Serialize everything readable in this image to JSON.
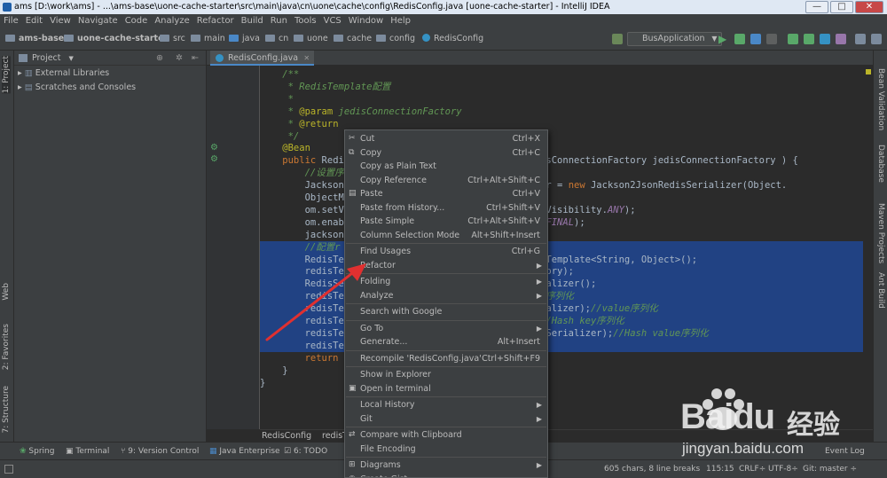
{
  "window": {
    "title": "ams [D:\\work\\ams] - ...\\ams-base\\uone-cache-starter\\src\\main\\java\\cn\\uone\\cache\\config\\RedisConfig.java [uone-cache-starter] - IntelliJ IDEA",
    "minimize": "—",
    "maximize": "□",
    "close": "✕"
  },
  "menu": [
    "File",
    "Edit",
    "View",
    "Navigate",
    "Code",
    "Analyze",
    "Refactor",
    "Build",
    "Run",
    "Tools",
    "VCS",
    "Window",
    "Help"
  ],
  "navbar": {
    "crumbs": [
      "ams-base",
      "uone-cache-starter",
      "src",
      "main",
      "java",
      "cn",
      "uone",
      "cache",
      "config",
      "RedisConfig"
    ],
    "run_config": "BusApplication"
  },
  "left_strip": {
    "project": "1: Project",
    "web": "Web",
    "favorites": "2: Favorites",
    "structure": "7: Structure"
  },
  "right_strip": {
    "bean": "Bean Validation",
    "database": "Database",
    "maven": "Maven Projects",
    "ant": "Ant Build"
  },
  "project_panel": {
    "header": "Project",
    "items": [
      "External Libraries",
      "Scratches and Consoles"
    ]
  },
  "editor": {
    "tab": "RedisConfig.java",
    "breadcrumbs": [
      "RedisConfig",
      "redisT"
    ]
  },
  "code_lines": [
    {
      "segments": [
        {
          "c": "cm",
          "t": "    /**"
        }
      ],
      "sel": false
    },
    {
      "segments": [
        {
          "c": "cm",
          "t": "     * RedisTemplate配置"
        }
      ],
      "sel": false
    },
    {
      "segments": [
        {
          "c": "cm",
          "t": "     *"
        }
      ],
      "sel": false
    },
    {
      "segments": [
        {
          "c": "cm",
          "t": "     * "
        },
        {
          "c": "an",
          "t": "@param"
        },
        {
          "c": "cm",
          "t": " jedisConnectionFactory"
        }
      ],
      "sel": false
    },
    {
      "segments": [
        {
          "c": "cm",
          "t": "     * "
        },
        {
          "c": "an",
          "t": "@return"
        }
      ],
      "sel": false
    },
    {
      "segments": [
        {
          "c": "cm",
          "t": "     */"
        }
      ],
      "sel": false
    },
    {
      "segments": [
        {
          "c": "an",
          "t": "    @Bean"
        }
      ],
      "sel": false
    },
    {
      "segments": [
        {
          "c": "kw",
          "t": "    public "
        },
        {
          "c": "",
          "t": "Redi                          plate(JedisConnectionFactory jedisConnectionFactory ) {"
        }
      ],
      "sel": false
    },
    {
      "segments": [
        {
          "c": "cm",
          "t": "        //设置序"
        }
      ],
      "sel": false
    },
    {
      "segments": [
        {
          "c": "",
          "t": "        Jackson                       edisSerializer = "
        },
        {
          "c": "kw",
          "t": "new "
        },
        {
          "c": "",
          "t": "Jackson2JsonRedisSerializer(Object."
        }
      ],
      "sel": false
    },
    {
      "segments": [
        {
          "c": "",
          "t": "        ObjectM"
        }
      ],
      "sel": false
    },
    {
      "segments": [
        {
          "c": "",
          "t": "        om.setV                       onAutoDetect.Visibility."
        },
        {
          "c": "it",
          "t": "ANY"
        },
        {
          "c": "",
          "t": ");"
        }
      ],
      "sel": false
    },
    {
      "segments": [
        {
          "c": "",
          "t": "        om.enab                       ltTyping."
        },
        {
          "c": "it",
          "t": "NON_FINAL"
        },
        {
          "c": "",
          "t": ");"
        }
      ],
      "sel": false
    },
    {
      "segments": [
        {
          "c": "",
          "t": "        jackson                       er(om);"
        }
      ],
      "sel": false
    },
    {
      "segments": [
        {
          "c": "cm",
          "t": "        //配置r"
        }
      ],
      "sel": true
    },
    {
      "segments": [
        {
          "c": "",
          "t": "        RedisTe                       e = "
        },
        {
          "c": "kw",
          "t": "new "
        },
        {
          "c": "",
          "t": "RedisTemplate<String, Object>();"
        }
      ],
      "sel": true
    },
    {
      "segments": [
        {
          "c": "",
          "t": "        redisTe                       onnectionFactory);"
        }
      ],
      "sel": true
    },
    {
      "segments": [
        {
          "c": "",
          "t": "        RedisSe                       ringRedisSerializer();"
        }
      ],
      "sel": true
    },
    {
      "segments": [
        {
          "c": "",
          "t": "        redisTe                       alizer);"
        },
        {
          "c": "cm",
          "t": "//key序列化"
        }
      ],
      "sel": true
    },
    {
      "segments": [
        {
          "c": "",
          "t": "        redisTe                       JsonRedisSerializer);"
        },
        {
          "c": "cm",
          "t": "//value序列化"
        }
      ],
      "sel": true
    },
    {
      "segments": [
        {
          "c": "",
          "t": "        redisTe                       Serializer);"
        },
        {
          "c": "cm",
          "t": "//Hash key序列化"
        }
      ],
      "sel": true
    },
    {
      "segments": [
        {
          "c": "",
          "t": "        redisTe                       son2JsonRedisSerializer);"
        },
        {
          "c": "cm",
          "t": "//Hash value序列化"
        }
      ],
      "sel": true
    },
    {
      "segments": [
        {
          "c": "",
          "t": "        redisTe"
        }
      ],
      "sel": true
    },
    {
      "segments": [
        {
          "c": "kw",
          "t": "        return "
        }
      ],
      "sel": false
    },
    {
      "segments": [
        {
          "c": "",
          "t": "    }"
        }
      ],
      "sel": false
    },
    {
      "segments": [
        {
          "c": "",
          "t": "}"
        }
      ],
      "sel": false
    }
  ],
  "context_menu": [
    {
      "type": "item",
      "icon": "✂",
      "label": "Cut",
      "shortcut": "Ctrl+X"
    },
    {
      "type": "item",
      "icon": "⧉",
      "label": "Copy",
      "shortcut": "Ctrl+C"
    },
    {
      "type": "item",
      "icon": "",
      "label": "Copy as Plain Text",
      "shortcut": ""
    },
    {
      "type": "item",
      "icon": "",
      "label": "Copy Reference",
      "shortcut": "Ctrl+Alt+Shift+C"
    },
    {
      "type": "item",
      "icon": "▤",
      "label": "Paste",
      "shortcut": "Ctrl+V"
    },
    {
      "type": "item",
      "icon": "",
      "label": "Paste from History...",
      "shortcut": "Ctrl+Shift+V"
    },
    {
      "type": "item",
      "icon": "",
      "label": "Paste Simple",
      "shortcut": "Ctrl+Alt+Shift+V"
    },
    {
      "type": "item",
      "icon": "",
      "label": "Column Selection Mode",
      "shortcut": "Alt+Shift+Insert"
    },
    {
      "type": "sep"
    },
    {
      "type": "item",
      "icon": "",
      "label": "Find Usages",
      "shortcut": "Ctrl+G"
    },
    {
      "type": "sub",
      "icon": "",
      "label": "Refactor"
    },
    {
      "type": "sep"
    },
    {
      "type": "sub",
      "icon": "",
      "label": "Folding"
    },
    {
      "type": "sub",
      "icon": "",
      "label": "Analyze"
    },
    {
      "type": "sep"
    },
    {
      "type": "item",
      "icon": "",
      "label": "Search with Google",
      "shortcut": ""
    },
    {
      "type": "sep"
    },
    {
      "type": "sub",
      "icon": "",
      "label": "Go To"
    },
    {
      "type": "item",
      "icon": "",
      "label": "Generate...",
      "shortcut": "Alt+Insert"
    },
    {
      "type": "sep"
    },
    {
      "type": "item",
      "icon": "",
      "label": "Recompile 'RedisConfig.java'",
      "shortcut": "Ctrl+Shift+F9"
    },
    {
      "type": "sep"
    },
    {
      "type": "item",
      "icon": "",
      "label": "Show in Explorer",
      "shortcut": ""
    },
    {
      "type": "item",
      "icon": "▣",
      "label": "Open in terminal",
      "shortcut": ""
    },
    {
      "type": "sep"
    },
    {
      "type": "sub",
      "icon": "",
      "label": "Local History"
    },
    {
      "type": "sub",
      "icon": "",
      "label": "Git"
    },
    {
      "type": "sep"
    },
    {
      "type": "item",
      "icon": "⇄",
      "label": "Compare with Clipboard",
      "shortcut": ""
    },
    {
      "type": "item",
      "icon": "",
      "label": "File Encoding",
      "shortcut": ""
    },
    {
      "type": "sep"
    },
    {
      "type": "sub",
      "icon": "⊞",
      "label": "Diagrams"
    },
    {
      "type": "item",
      "icon": "◉",
      "label": "Create Gist...",
      "shortcut": ""
    }
  ],
  "tool_windows": [
    "Spring",
    "Terminal",
    "9: Version Control",
    "Java Enterprise",
    "6: TODO",
    "Event Log"
  ],
  "status": {
    "chars": "605 chars, 8 line breaks",
    "position": "115:15",
    "line_sep": "CRLF÷",
    "encoding": "UTF-8÷",
    "git": "Git: master ÷"
  },
  "watermark": {
    "brand": "Baidu",
    "cn": "经验",
    "url": "jingyan.baidu.com"
  },
  "colors": {
    "selection": "#214283",
    "accent": "#4a88c7",
    "arrow": "#e03030"
  }
}
